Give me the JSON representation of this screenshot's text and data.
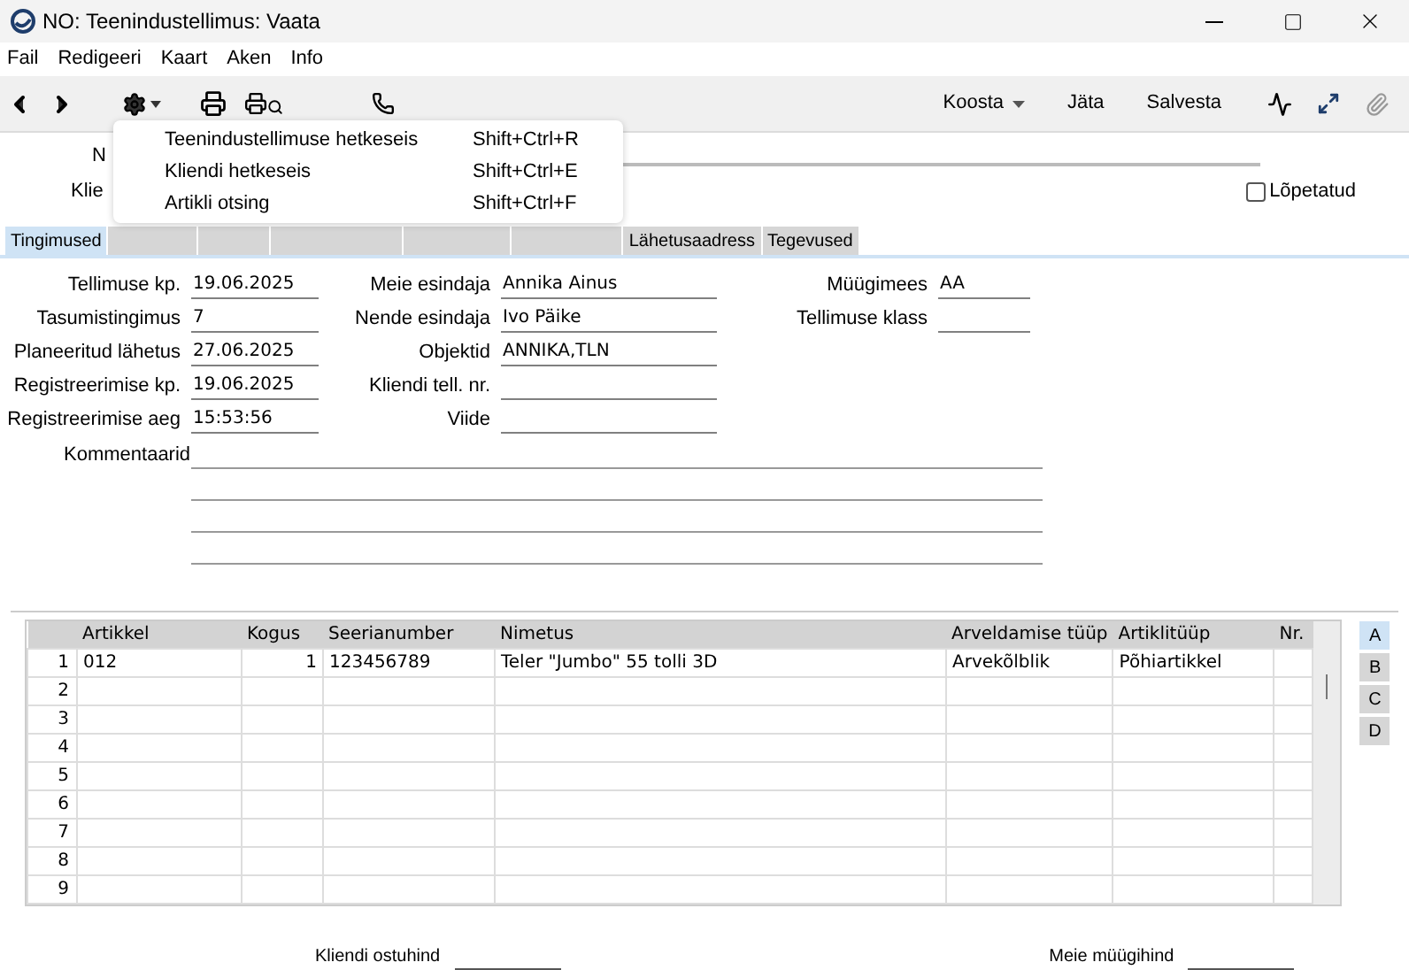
{
  "window": {
    "title": "NO: Teenindustellimus: Vaata"
  },
  "menu_bar": [
    "Fail",
    "Redigeeri",
    "Kaart",
    "Aken",
    "Info"
  ],
  "toolbar": {
    "buttons": [
      {
        "label": "Koosta",
        "kind": "dropdown"
      },
      {
        "label": "Jäta",
        "kind": "plain"
      },
      {
        "label": "Salvesta",
        "kind": "plain"
      }
    ]
  },
  "dropdown_menu": [
    {
      "label": "Teenindustellimuse hetkeseis",
      "shortcut": "Shift+Ctrl+R"
    },
    {
      "label": "Kliendi hetkeseis",
      "shortcut": "Shift+Ctrl+E"
    },
    {
      "label": "Artikli otsing",
      "shortcut": "Shift+Ctrl+F"
    }
  ],
  "header": {
    "label_1": "N",
    "label_2": "Klie",
    "closed": {
      "label": "Lõpetatud",
      "checked": false
    }
  },
  "tabs": [
    {
      "label": "Tingimused",
      "selected": true
    },
    {
      "selected": false
    },
    {
      "selected": false
    },
    {
      "selected": false
    },
    {
      "selected": false
    },
    {
      "selected": false
    },
    {
      "label": "Lähetusaadress",
      "selected": false
    },
    {
      "label": "Tegevused",
      "selected": false
    }
  ],
  "fields_col1": [
    {
      "label": "Tellimuse kp.",
      "value": "19.06.2025"
    },
    {
      "label": "Tasumistingimus",
      "value": "7"
    },
    {
      "label": "Planeeritud lähetus",
      "value": "27.06.2025"
    },
    {
      "label": "Registreerimise kp.",
      "value": "19.06.2025"
    },
    {
      "label": "Registreerimise aeg",
      "value": "15:53:56"
    }
  ],
  "fields_col2": [
    {
      "label": "Meie esindaja",
      "value": "Annika Ainus"
    },
    {
      "label": "Nende esindaja",
      "value": "Ivo Päike"
    },
    {
      "label": "Objektid",
      "value": "ANNIKA,TLN"
    },
    {
      "label": "Kliendi tell. nr."
    },
    {
      "label": "Viide"
    }
  ],
  "fields_col3": [
    {
      "label": "Müügimees",
      "value": "AA"
    },
    {
      "label": "Tellimuse klass"
    }
  ],
  "comments_label": "Kommentaarid",
  "table": {
    "columns": [
      "Artikkel",
      "Kogus",
      "Seerianumber",
      "Nimetus",
      "Arveldamise tüüp",
      "Artiklitüüp",
      "Nr."
    ],
    "rows": [
      {
        "num": "1",
        "cells": [
          "012",
          "1",
          "123456789",
          "Teler \"Jumbo\" 55 tolli 3D",
          "Arvekõlblik",
          "Põhiartikkel",
          ""
        ]
      },
      {
        "num": "2",
        "cells": [
          "",
          "",
          "",
          "",
          "",
          "",
          ""
        ]
      },
      {
        "num": "3",
        "cells": [
          "",
          "",
          "",
          "",
          "",
          "",
          ""
        ]
      },
      {
        "num": "4",
        "cells": [
          "",
          "",
          "",
          "",
          "",
          "",
          ""
        ]
      },
      {
        "num": "5",
        "cells": [
          "",
          "",
          "",
          "",
          "",
          "",
          ""
        ]
      },
      {
        "num": "6",
        "cells": [
          "",
          "",
          "",
          "",
          "",
          "",
          ""
        ]
      },
      {
        "num": "7",
        "cells": [
          "",
          "",
          "",
          "",
          "",
          "",
          ""
        ]
      },
      {
        "num": "8",
        "cells": [
          "",
          "",
          "",
          "",
          "",
          "",
          ""
        ]
      },
      {
        "num": "9",
        "cells": [
          "",
          "",
          "",
          "",
          "",
          "",
          ""
        ]
      }
    ]
  },
  "side_tabs": [
    {
      "label": "A",
      "selected": true
    },
    {
      "label": "B",
      "selected": false
    },
    {
      "label": "C",
      "selected": false
    },
    {
      "label": "D",
      "selected": false
    }
  ],
  "footer": [
    {
      "label": "Kliendi ostuhind"
    },
    {
      "label": "Meie müügihind"
    }
  ]
}
